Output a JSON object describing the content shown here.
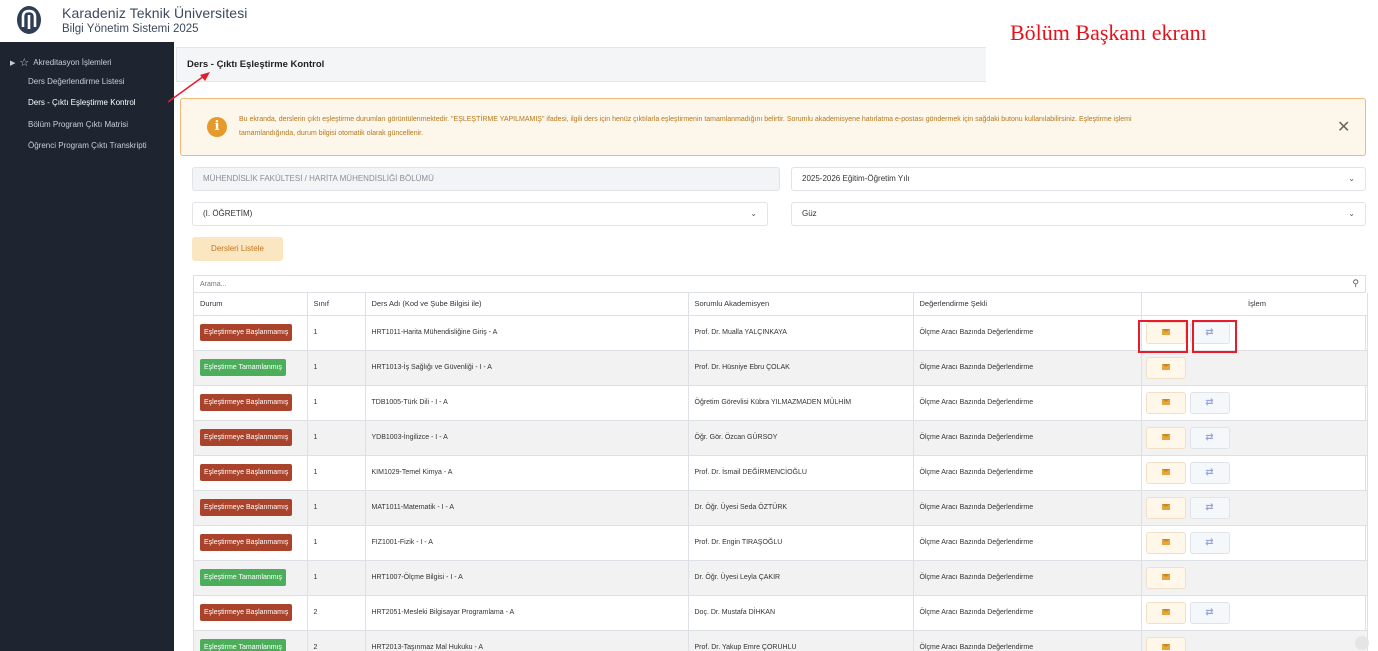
{
  "header": {
    "university": "Karadeniz Teknik Üniversitesi",
    "system": "Bilgi Yönetim Sistemi 2025",
    "annotation": "Bölüm Başkanı ekranı"
  },
  "sidebar": {
    "section": "Akreditasyon İşlemleri",
    "items": [
      {
        "label": "Ders Değerlendirme Listesi"
      },
      {
        "label": "Ders - Çıktı Eşleştirme Kontrol"
      },
      {
        "label": "Bölüm Program Çıktı Matrisi"
      },
      {
        "label": "Öğrenci Program Çıktı Transkripti"
      }
    ]
  },
  "page": {
    "title": "Ders - Çıktı Eşleştirme Kontrol"
  },
  "alert": {
    "line1": "Bu ekranda, derslerin çıktı eşleştirme durumları görüntülenmektedir. \"EŞLEŞTİRME YAPILMAMIŞ\" ifadesi, ilgili ders için henüz çıktılarla eşleştirmenin tamamlanmadığını belirtir. Sorumlu akademisyene hatırlatma e-postası göndermek için sağdaki butonu kullanılabilirsiniz. Eşleştirme işlemi",
    "line2": "tamamlandığında, durum bilgisi otomatik olarak güncellenir."
  },
  "filters": {
    "faculty": "MÜHENDİSLİK FAKÜLTESİ / HARİTA MÜHENDİSLİĞİ BÖLÜMÜ",
    "year": "2025-2026 Eğitim-Öğretim Yılı",
    "program": "(I. ÖĞRETİM)",
    "term": "Güz",
    "list_button": "Dersleri Listele"
  },
  "table": {
    "search_placeholder": "Arama...",
    "columns": [
      "Durum",
      "Sınıf",
      "Ders Adı (Kod ve Şube Bilgisi ile)",
      "Sorumlu Akademisyen",
      "Değerlendirme Şekli",
      "İşlem"
    ],
    "rows": [
      {
        "status": "Eşleştirmeye Başlanmamış",
        "status_color": "red",
        "class": "1",
        "course": "HRT1011-Harita Mühendisliğine Giriş - A",
        "lecturer": "Prof. Dr. Mualla YALÇINKAYA",
        "method": "Ölçme Aracı Bazında Değerlendirme",
        "map": true
      },
      {
        "status": "Eşleştirme Tamamlanmış",
        "status_color": "green",
        "class": "1",
        "course": "HRT1013-İş Sağlığı ve Güvenliği - I - A",
        "lecturer": "Prof. Dr. Hüsniye Ebru ÇOLAK",
        "method": "Ölçme Aracı Bazında Değerlendirme",
        "map": false
      },
      {
        "status": "Eşleştirmeye Başlanmamış",
        "status_color": "red",
        "class": "1",
        "course": "TDB1005-Türk Dili - I - A",
        "lecturer": "Öğretim Görevlisi Kübra YILMAZMADEN MÜLHİM",
        "method": "Ölçme Aracı Bazında Değerlendirme",
        "map": true
      },
      {
        "status": "Eşleştirmeye Başlanmamış",
        "status_color": "red",
        "class": "1",
        "course": "YDB1003-İngilizce - I - A",
        "lecturer": "Öğr. Gör. Özcan GÜRSOY",
        "method": "Ölçme Aracı Bazında Değerlendirme",
        "map": true
      },
      {
        "status": "Eşleştirmeye Başlanmamış",
        "status_color": "red",
        "class": "1",
        "course": "KIM1029-Temel Kimya - A",
        "lecturer": "Prof. Dr. İsmail DEĞİRMENCİOĞLU",
        "method": "Ölçme Aracı Bazında Değerlendirme",
        "map": true
      },
      {
        "status": "Eşleştirmeye Başlanmamış",
        "status_color": "red",
        "class": "1",
        "course": "MAT1011-Matematik - I - A",
        "lecturer": "Dr. Öğr. Üyesi Seda ÖZTÜRK",
        "method": "Ölçme Aracı Bazında Değerlendirme",
        "map": true
      },
      {
        "status": "Eşleştirmeye Başlanmamış",
        "status_color": "red",
        "class": "1",
        "course": "FIZ1001-Fizik - I - A",
        "lecturer": "Prof. Dr. Engin TIRAŞOĞLU",
        "method": "Ölçme Aracı Bazında Değerlendirme",
        "map": true
      },
      {
        "status": "Eşleştirme Tamamlanmış",
        "status_color": "green",
        "class": "1",
        "course": "HRT1007-Ölçme Bilgisi - I - A",
        "lecturer": "Dr. Öğr. Üyesi Leyla ÇAKIR",
        "method": "Ölçme Aracı Bazında Değerlendirme",
        "map": false
      },
      {
        "status": "Eşleştirmeye Başlanmamış",
        "status_color": "red",
        "class": "2",
        "course": "HRT2051-Mesleki Bilgisayar Programlama - A",
        "lecturer": "Doç. Dr. Mustafa DİHKAN",
        "method": "Ölçme Aracı Bazında Değerlendirme",
        "map": true
      },
      {
        "status": "Eşleştirme Tamamlanmış",
        "status_color": "green",
        "class": "2",
        "course": "HRT2013-Taşınmaz Mal Hukuku - A",
        "lecturer": "Prof. Dr. Yakup Emre ÇORUHLU",
        "method": "Ölçme Aracı Bazında Değerlendirme",
        "map": false
      }
    ]
  },
  "icons": {
    "mail": "envelope-icon",
    "map": "mapping-icon",
    "search": "search-icon",
    "close": "close-icon",
    "info": "info-icon"
  },
  "colors": {
    "sidebar_bg": "#1e2530",
    "badge_red": "#a9432b",
    "badge_green": "#4cae5b",
    "annotation_red": "#e8111a",
    "alert_bg": "#fdf6ea"
  }
}
